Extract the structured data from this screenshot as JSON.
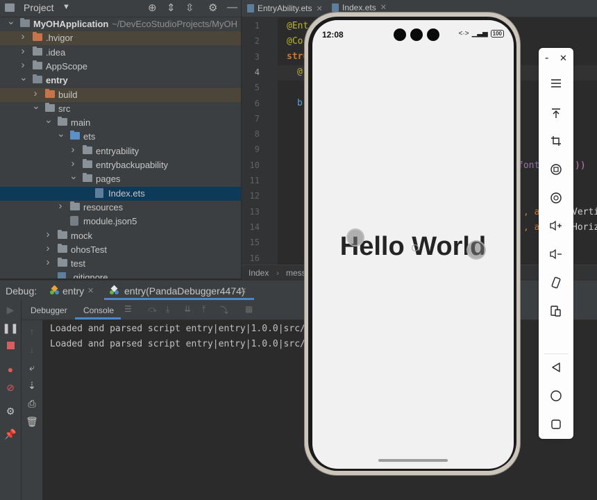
{
  "project_panel": {
    "title": "Project",
    "tree": [
      {
        "label": "MyOHApplication",
        "suffix": "~/DevEcoStudioProjects/MyOH",
        "level": 0,
        "arrow": "down",
        "type": "module"
      },
      {
        "label": ".hvigor",
        "level": 1,
        "arrow": "right",
        "type": "folder-orange"
      },
      {
        "label": ".idea",
        "level": 1,
        "arrow": "right",
        "type": "folder"
      },
      {
        "label": "AppScope",
        "level": 1,
        "arrow": "right",
        "type": "folder"
      },
      {
        "label": "entry",
        "level": 1,
        "arrow": "down",
        "type": "module"
      },
      {
        "label": "build",
        "level": 2,
        "arrow": "right",
        "type": "folder-orange"
      },
      {
        "label": "src",
        "level": 2,
        "arrow": "down",
        "type": "folder"
      },
      {
        "label": "main",
        "level": 3,
        "arrow": "down",
        "type": "folder"
      },
      {
        "label": "ets",
        "level": 4,
        "arrow": "down",
        "type": "folder-blue"
      },
      {
        "label": "entryability",
        "level": 5,
        "arrow": "right",
        "type": "folder"
      },
      {
        "label": "entrybackupability",
        "level": 5,
        "arrow": "right",
        "type": "folder"
      },
      {
        "label": "pages",
        "level": 5,
        "arrow": "down",
        "type": "folder"
      },
      {
        "label": "Index.ets",
        "level": 6,
        "arrow": "",
        "type": "file"
      },
      {
        "label": "resources",
        "level": 4,
        "arrow": "right",
        "type": "folder"
      },
      {
        "label": "module.json5",
        "level": 4,
        "arrow": "",
        "type": "file-config"
      },
      {
        "label": "mock",
        "level": 3,
        "arrow": "right",
        "type": "folder"
      },
      {
        "label": "ohosTest",
        "level": 3,
        "arrow": "right",
        "type": "folder"
      },
      {
        "label": "test",
        "level": 3,
        "arrow": "right",
        "type": "folder"
      },
      {
        "label": ".gitignore",
        "level": 3,
        "arrow": "",
        "type": "file"
      }
    ]
  },
  "editor": {
    "tabs": [
      {
        "label": "EntryAbility.ets",
        "active": false
      },
      {
        "label": "Index.ets",
        "active": true
      }
    ],
    "line_numbers": [
      "1",
      "2",
      "3",
      "4",
      "5",
      "6",
      "7",
      "8",
      "9",
      "10",
      "11",
      "12",
      "13",
      "14",
      "15",
      "16"
    ],
    "current_line": "4",
    "code": {
      "l1": "@Ent",
      "l2": "@Co",
      "l3": "stru",
      "l4": "@",
      "l6": "b",
      "l10": "font",
      "l10b": "))",
      "l13": ", a",
      "l13b": "Verti",
      "l14": ", a",
      "l14b": "Horiz"
    },
    "breadcrumb": [
      "Index",
      "mess"
    ]
  },
  "debug": {
    "label": "Debug:",
    "sessions": [
      {
        "label": "entry"
      },
      {
        "label": "entry(PandaDebugger4474)"
      }
    ],
    "subtabs": [
      "Debugger",
      "Console"
    ],
    "console_lines": [
      "Loaded and parsed script entry|entry|1.0.0|src/",
      "Loaded and parsed script entry|entry|1.0.0|src/"
    ]
  },
  "phone": {
    "time": "12:08",
    "battery": "100",
    "hello_text": "Hello World"
  },
  "emulator_toolbar": {
    "minimize": "-",
    "close": "✕"
  },
  "colors": {
    "panel": "#3c3f41",
    "editor": "#2b2b2b",
    "selection_blue": "#0d3a58",
    "accent": "#4a88c7"
  }
}
